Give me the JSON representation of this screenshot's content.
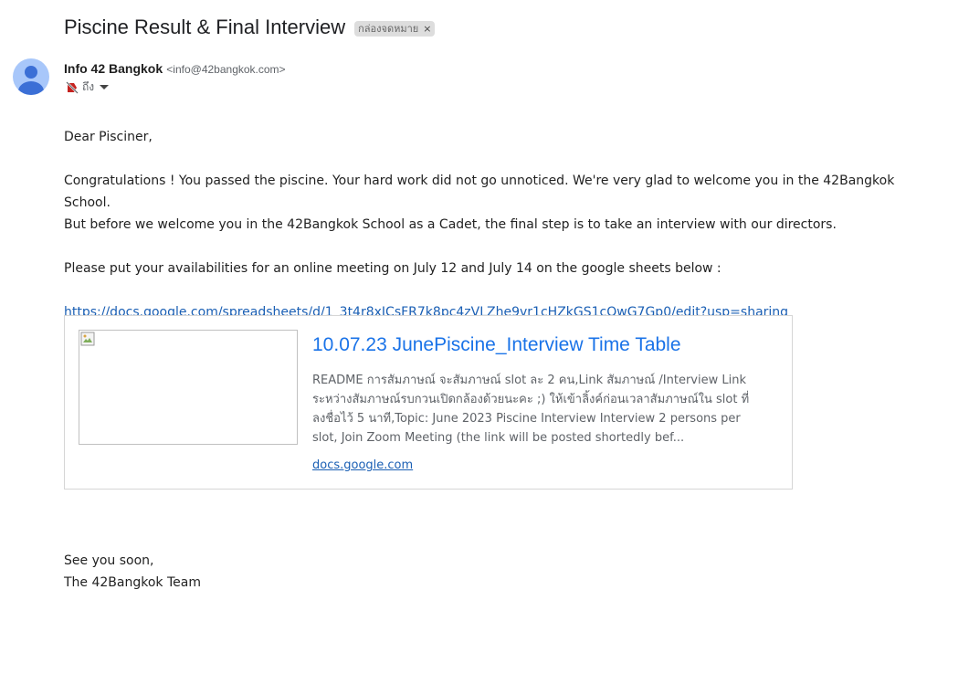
{
  "email": {
    "subject": "Piscine Result & Final Interview",
    "label_chip": {
      "text": "กล่องจดหมาย",
      "remove_glyph": "×"
    },
    "sender": {
      "name": "Info 42 Bangkok",
      "email": "<info@42bangkok.com>",
      "to_label": "ถึง",
      "avatar_icon": "person-avatar-icon",
      "important_icon": "label-off-icon"
    },
    "body": {
      "greeting": "Dear Pisciner,",
      "paragraph1_line1": "Congratulations ! You passed the piscine. Your hard work did not go unnoticed. We're very glad to welcome you in the 42Bangkok School.",
      "paragraph1_line2": "But before we welcome you in the 42Bangkok School as a Cadet, the final step is to take an interview with our directors.",
      "paragraph2": "Please put your availabilities for an online meeting on July 12 and July 14 on the google sheets below :",
      "link": "https://docs.google.com/spreadsheets/d/1_3t4r8xICsFR7k8pc4zVLZhe9vr1cHZkGS1cQwG7Gp0/edit?usp=sharing"
    },
    "link_preview": {
      "title": "10.07.23 JunePiscine_Interview Time Table",
      "description": "README การสัมภาษณ์ จะสัมภาษณ์ slot ละ 2 คน,Link สัมภาษณ์ /Interview Link ระหว่างสัมภาษณ์รบกวนเปิดกล้องด้วยนะคะ ;) ให้เข้าลิ้งค์ก่อนเวลาสัมภาษณ์ใน slot ที่ลงชื่อไว้ 5 นาที,Topic: June 2023 Piscine Interview Interview 2 persons per slot, Join Zoom Meeting (the link will be posted shortedly bef...",
      "domain": "docs.google.com"
    },
    "signoff": {
      "line1": "See you soon,",
      "line2": "The 42Bangkok Team"
    }
  },
  "colors": {
    "link": "#1a5fb4",
    "preview_title": "#1a73e8",
    "avatar_bg": "#a8c7fa",
    "avatar_fg": "#3b6fd6",
    "important_icon": "#c5221f"
  }
}
